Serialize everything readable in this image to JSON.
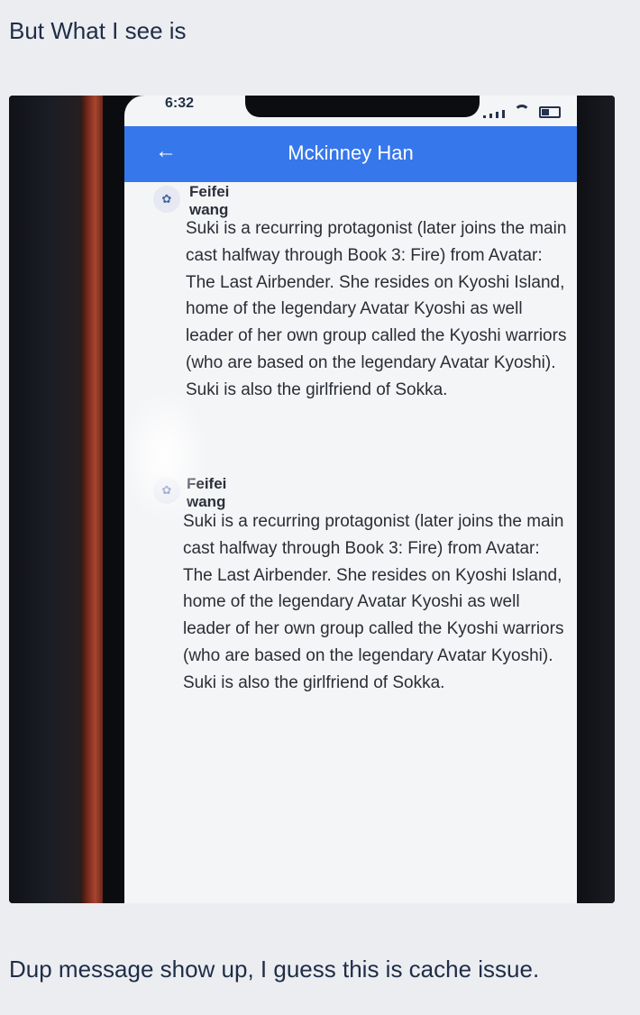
{
  "post": {
    "intro": "But What I see is",
    "outro": "Dup message show up, I guess this is cache issue."
  },
  "phone": {
    "status_time": "6:32",
    "header_title": "Mckinney Han",
    "back_icon": "←",
    "messages": [
      {
        "sender": "Feifei wang",
        "text": "Suki is a recurring protagonist (later joins the main cast halfway through Book 3: Fire) from Avatar: The Last Airbender. She resides on Kyoshi Island, home of the legendary Avatar Kyoshi as well leader of her own group called the Kyoshi warriors (who are based on the legendary Avatar Kyoshi). Suki is also the girlfriend of Sokka."
      },
      {
        "sender": "Feifei wang",
        "text": "Suki is a recurring protagonist (later joins the main cast halfway through Book 3: Fire) from Avatar: The Last Airbender. She resides on Kyoshi Island, home of the legendary Avatar Kyoshi as well leader of her own group called the Kyoshi warriors (who are based on the legendary Avatar Kyoshi). Suki is also the girlfriend of Sokka."
      }
    ],
    "colors": {
      "header": "#3677ec",
      "screen": "#f4f5f7"
    }
  }
}
